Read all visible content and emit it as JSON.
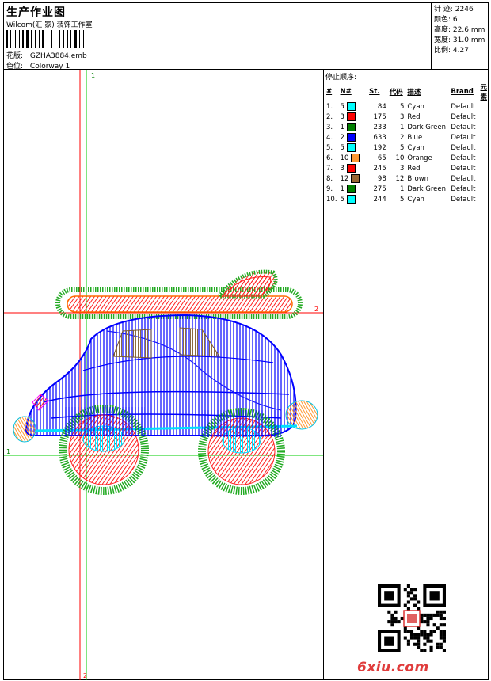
{
  "header": {
    "title": "生产作业图",
    "company": "Wilcom(汇 家) 装饰工作室",
    "design_label": "花版:",
    "design_value": "GZHA3884.emb",
    "colorway_label": "色位:",
    "colorway_value": "Colorway 1"
  },
  "stats": {
    "stitches_label": "针 迹:",
    "stitches_value": "2246",
    "colors_label": "颜色:",
    "colors_value": "6",
    "height_label": "高度:",
    "height_value": "22.6 mm",
    "width_label": "宽度:",
    "width_value": "31.0 mm",
    "scale_label": "比例:",
    "scale_value": "4.27"
  },
  "guides": {
    "v_label_top": "1",
    "v_label_bottom": "2",
    "h_label_left": "1",
    "h_label_right": "2"
  },
  "stop_sequence": {
    "title": "停止顺序:",
    "columns": [
      "#",
      "N#",
      "St.",
      "代码",
      "描述",
      "Brand",
      "元素"
    ],
    "rows": [
      {
        "idx": "1.",
        "n": "5",
        "color": "#00ffff",
        "st": "84",
        "code": "5",
        "desc": "Cyan",
        "brand": "Default"
      },
      {
        "idx": "2.",
        "n": "3",
        "color": "#ff0000",
        "st": "175",
        "code": "3",
        "desc": "Red",
        "brand": "Default"
      },
      {
        "idx": "3.",
        "n": "1",
        "color": "#008000",
        "st": "233",
        "code": "1",
        "desc": "Dark Green",
        "brand": "Default"
      },
      {
        "idx": "4.",
        "n": "2",
        "color": "#0000ff",
        "st": "633",
        "code": "2",
        "desc": "Blue",
        "brand": "Default"
      },
      {
        "idx": "5.",
        "n": "5",
        "color": "#00ffff",
        "st": "192",
        "code": "5",
        "desc": "Cyan",
        "brand": "Default"
      },
      {
        "idx": "6.",
        "n": "10",
        "color": "#ff9933",
        "st": "65",
        "code": "10",
        "desc": "Orange",
        "brand": "Default"
      },
      {
        "idx": "7.",
        "n": "3",
        "color": "#ff0000",
        "st": "245",
        "code": "3",
        "desc": "Red",
        "brand": "Default"
      },
      {
        "idx": "8.",
        "n": "12",
        "color": "#996633",
        "st": "98",
        "code": "12",
        "desc": "Brown",
        "brand": "Default"
      },
      {
        "idx": "9.",
        "n": "1",
        "color": "#008000",
        "st": "275",
        "code": "1",
        "desc": "Dark Green",
        "brand": "Default"
      },
      {
        "idx": "10.",
        "n": "5",
        "color": "#00ffff",
        "st": "244",
        "code": "5",
        "desc": "Cyan",
        "brand": "Default"
      }
    ]
  },
  "watermark": {
    "brand": "6xiu.com"
  }
}
